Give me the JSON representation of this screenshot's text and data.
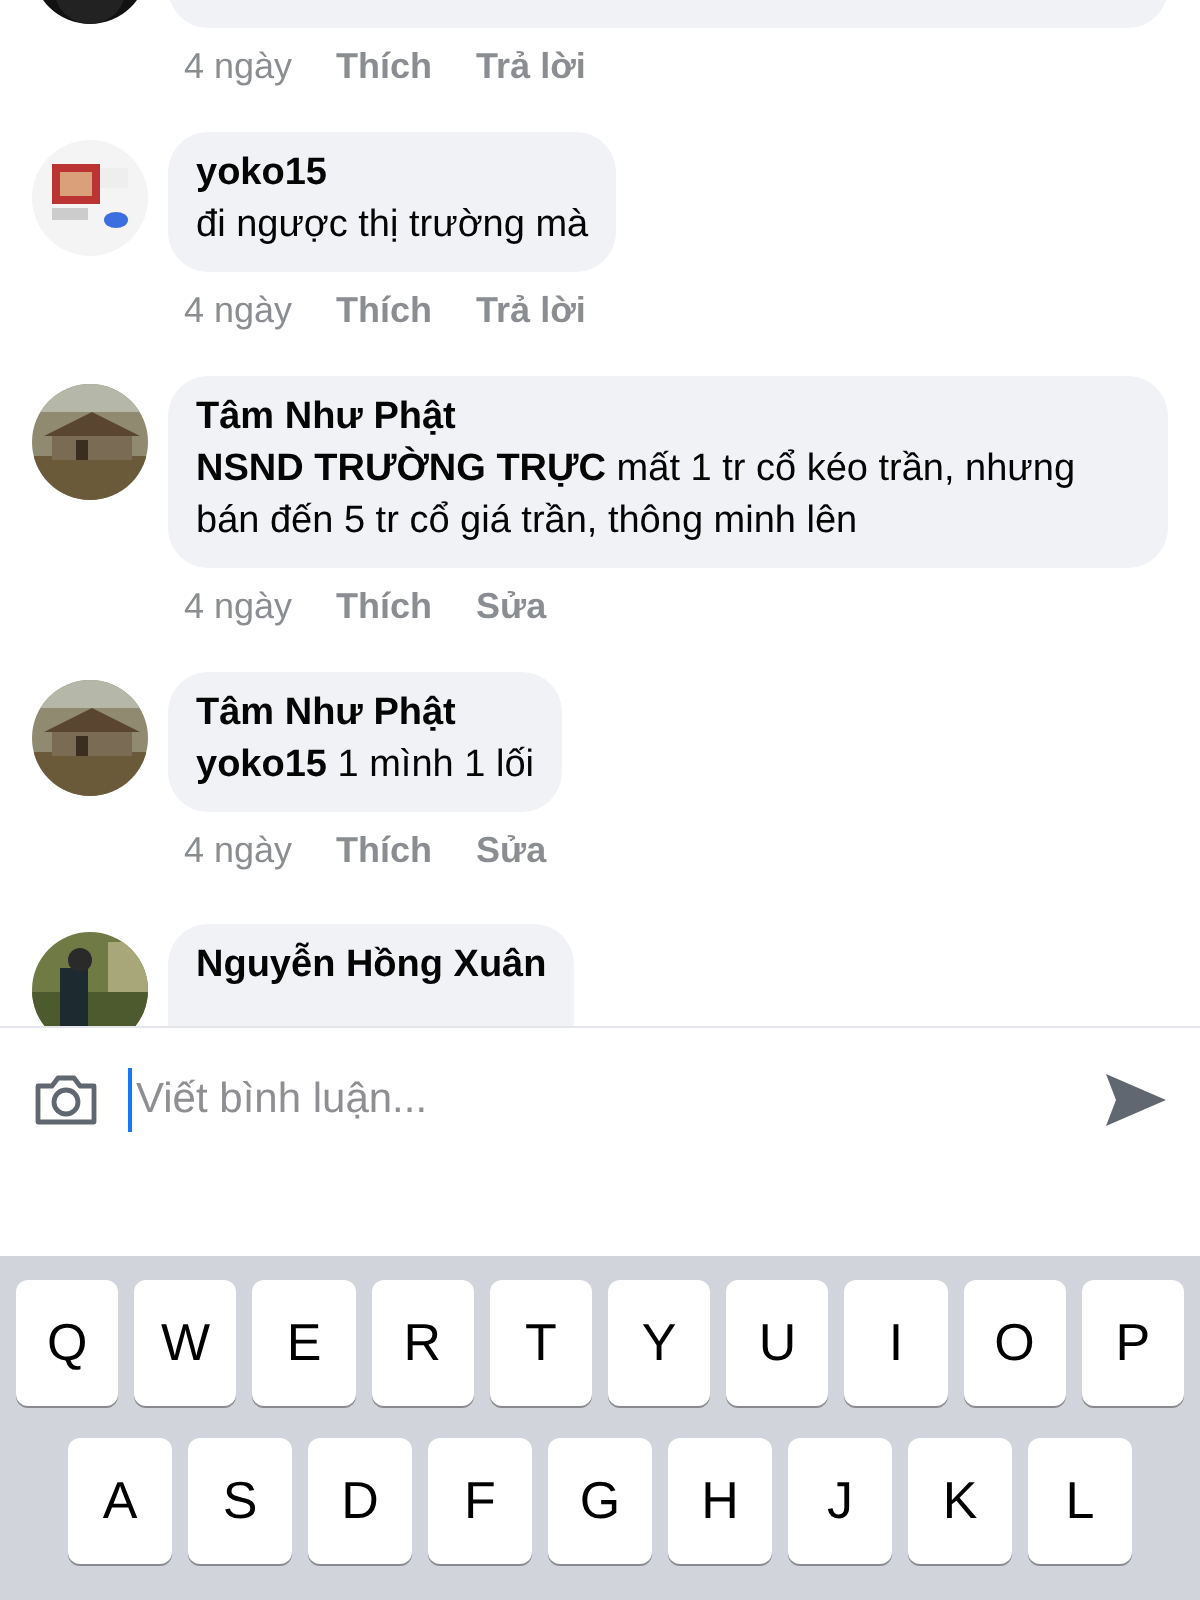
{
  "comments": [
    {
      "time": "4 ngày",
      "actions": [
        {
          "label": "Thích"
        },
        {
          "label": "Trả lời"
        }
      ]
    },
    {
      "name": "yoko15",
      "text": "đi ngược thị trường mà",
      "time": "4 ngày",
      "actions": [
        {
          "label": "Thích"
        },
        {
          "label": "Trả lời"
        }
      ]
    },
    {
      "name": "Tâm Như Phật",
      "text": "**NSND TRƯỜNG TRỰC**  mất 1 tr cổ kéo trần, nhưng bán đến 5 tr cổ giá trần, thông minh lên",
      "time": "4 ngày",
      "actions": [
        {
          "label": "Thích"
        },
        {
          "label": "Sửa"
        }
      ]
    },
    {
      "name": "Tâm Như Phật",
      "text": "**yoko15**  1 mình 1 lối",
      "time": "4 ngày",
      "actions": [
        {
          "label": "Thích"
        },
        {
          "label": "Sửa"
        }
      ]
    },
    {
      "name": "Nguyễn Hồng Xuân"
    }
  ],
  "composer": {
    "placeholder": "Viết bình luận..."
  },
  "keyboard": {
    "rows": [
      [
        "Q",
        "W",
        "E",
        "R",
        "T",
        "Y",
        "U",
        "I",
        "O",
        "P"
      ],
      [
        "A",
        "S",
        "D",
        "F",
        "G",
        "H",
        "J",
        "K",
        "L"
      ]
    ]
  }
}
